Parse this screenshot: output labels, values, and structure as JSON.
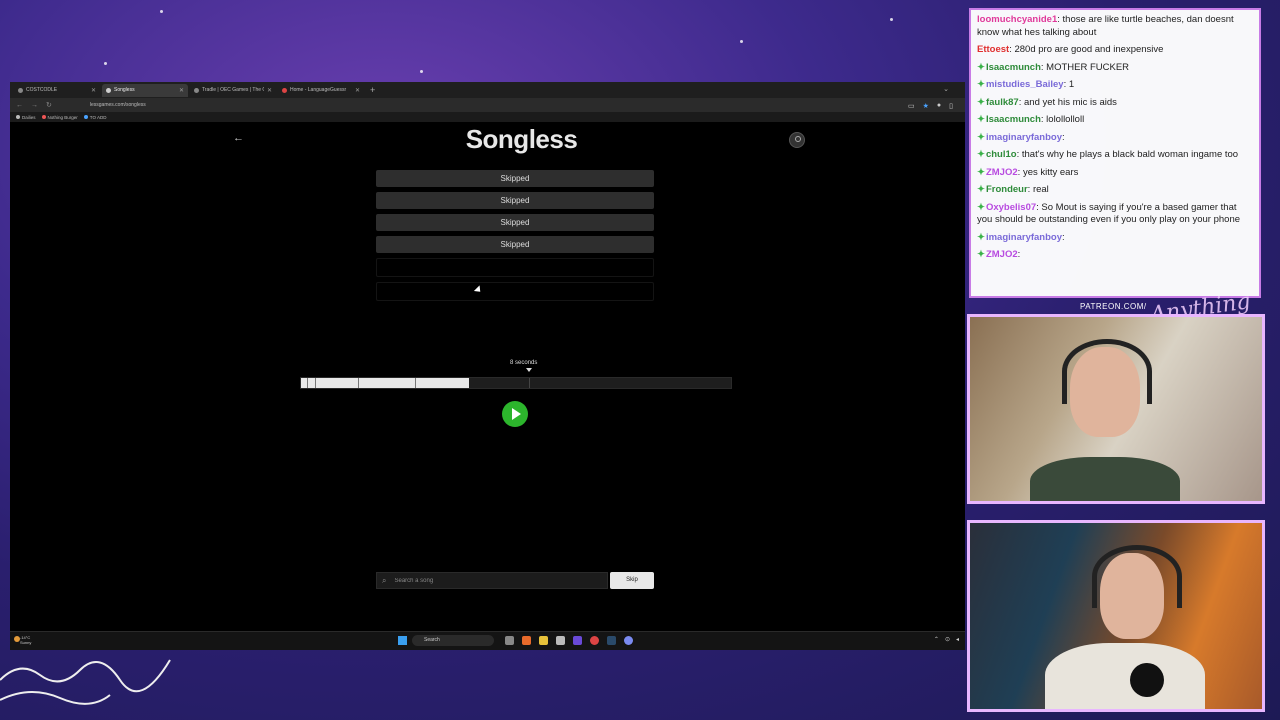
{
  "browser": {
    "tabs": [
      {
        "label": "COSTCODLE"
      },
      {
        "label": "Songless"
      },
      {
        "label": "Tradle | OEC Games | The Obse"
      },
      {
        "label": "Home - LanguageGuessr"
      }
    ],
    "url": "lessgames.com/songless",
    "bookmarks": [
      "Dailies",
      "Nothing Burger",
      "TO ADD"
    ]
  },
  "app": {
    "title": "Songless",
    "guesses": [
      "Skipped",
      "Skipped",
      "Skipped",
      "Skipped",
      "",
      ""
    ],
    "seconds_label": "8 seconds",
    "progress_fraction": 0.39,
    "search_placeholder": "Search a song",
    "skip_label": "Skip"
  },
  "taskbar": {
    "weather_temp": "-14°C",
    "weather_desc": "Sunny",
    "search_label": "Search"
  },
  "chat": [
    {
      "user": "loomuchcyanide1",
      "text": "those are like turtle beaches, dan doesnt know what hes talking about",
      "color": "#e0399a",
      "badge": false
    },
    {
      "user": "Ettoest",
      "text": "280d pro are good and inexpensive",
      "color": "#e03030",
      "badge": false
    },
    {
      "user": "Isaacmunch",
      "text": "MOTHER FUCKER",
      "color": "#2e8b3a",
      "badge": true
    },
    {
      "user": "mistudies_Bailey",
      "text": "1",
      "color": "#7a6ad8",
      "badge": true
    },
    {
      "user": "faulk87",
      "text": "and yet his mic is aids",
      "color": "#2e8b3a",
      "badge": true
    },
    {
      "user": "Isaacmunch",
      "text": "lolollolloll",
      "color": "#2e8b3a",
      "badge": true
    },
    {
      "user": "imaginaryfanboy",
      "text": "",
      "color": "#7a6ad8",
      "badge": true
    },
    {
      "user": "chul1o",
      "text": "that's why he plays a black bald woman ingame too",
      "color": "#2e8b3a",
      "badge": true
    },
    {
      "user": "ZMJO2",
      "text": "yes kitty ears",
      "color": "#b84be0",
      "badge": true
    },
    {
      "user": "Frondeur",
      "text": "real",
      "color": "#2e8b3a",
      "badge": true
    },
    {
      "user": "Oxybelis07",
      "text": "So Mout is saying if you're a based gamer that you should be outstanding even if you only play on your phone",
      "color": "#b84be0",
      "badge": true
    },
    {
      "user": "imaginaryfanboy",
      "text": "",
      "color": "#7a6ad8",
      "badge": true
    },
    {
      "user": "ZMJO2",
      "text": "",
      "color": "#b84be0",
      "badge": true
    }
  ],
  "overlay": {
    "patreon": "PATREON.COM/"
  },
  "colors": {
    "play_button": "#2cb52c",
    "chat_border": "#c87ce6",
    "cam_border": "#e8b6ff"
  }
}
